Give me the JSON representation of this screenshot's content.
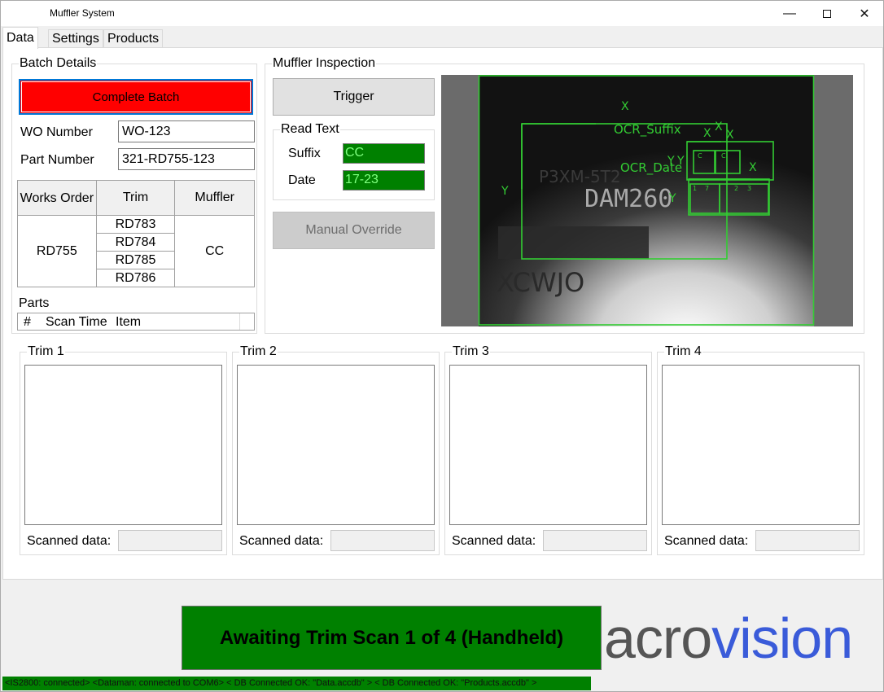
{
  "window": {
    "title": "Muffler System"
  },
  "tabs": [
    "Data",
    "Settings",
    "Products"
  ],
  "batch": {
    "group_title": "Batch Details",
    "complete_button": "Complete Batch",
    "wo_label": "WO Number",
    "wo_value": "WO-123",
    "part_label": "Part Number",
    "part_value": "321-RD755-123",
    "table_headers": [
      "Works Order",
      "Trim",
      "Muffler"
    ],
    "works_order": "RD755",
    "trims": [
      "RD783",
      "RD784",
      "RD785",
      "RD786"
    ],
    "muffler": "CC",
    "parts_label": "Parts",
    "parts_columns": [
      "#",
      "Scan Time",
      "Item"
    ]
  },
  "inspection": {
    "group_title": "Muffler Inspection",
    "trigger_button": "Trigger",
    "read_text_title": "Read Text",
    "suffix_label": "Suffix",
    "suffix_value": "CC",
    "date_label": "Date",
    "date_value": "17-23",
    "override_button": "Manual Override",
    "camera": {
      "embossed_line": "DAM260",
      "embossed_small": "P3XM-5T2",
      "embossed_bottom": "XCWJO",
      "ocr_suffix_label": "OCR_Suffix",
      "ocr_date_label": "OCR_Date",
      "axis_x": "X",
      "axis_y": "Y",
      "char_c": "C",
      "digits": [
        "1",
        "7",
        "2",
        "3"
      ]
    }
  },
  "trims": [
    {
      "title": "Trim 1",
      "scanned_label": "Scanned data:"
    },
    {
      "title": "Trim 2",
      "scanned_label": "Scanned data:"
    },
    {
      "title": "Trim 3",
      "scanned_label": "Scanned data:"
    },
    {
      "title": "Trim 4",
      "scanned_label": "Scanned data:"
    }
  ],
  "status": {
    "message": "Awaiting Trim Scan 1 of 4 (Handheld)",
    "bar": "<IS2800: connected>  <Dataman: connected to COM6>  < DB Connected OK: \"Data.accdb\" >  < DB Connected OK: \"Products.accdb\" >"
  },
  "logo": {
    "part1": "acro",
    "part2": "vision",
    "color1": "#555555",
    "color2": "#3a5bd9"
  },
  "colors": {
    "complete_button": "#ff0000",
    "ok_green": "#008000",
    "ocr_green": "#33cc33"
  }
}
